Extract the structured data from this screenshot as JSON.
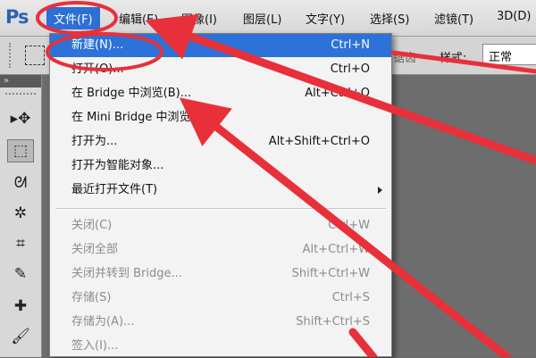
{
  "app": {
    "logo": "Ps"
  },
  "menubar": {
    "items": [
      {
        "label": "文件(F)"
      },
      {
        "label": "编辑(E)"
      },
      {
        "label": "图像(I)"
      },
      {
        "label": "图层(L)"
      },
      {
        "label": "文字(Y)"
      },
      {
        "label": "选择(S)"
      },
      {
        "label": "滤镜(T)"
      },
      {
        "label": "3D(D)"
      }
    ]
  },
  "options_bar": {
    "antialias_fragment": "锯齿",
    "style_label": "样式:",
    "style_value": "正常"
  },
  "toolbox": {
    "header": "»",
    "tools": [
      {
        "icon": "move-icon",
        "glyph": "▸✥"
      },
      {
        "icon": "marquee-icon",
        "glyph": "⬚"
      },
      {
        "icon": "lasso-icon",
        "glyph": "ᘛ"
      },
      {
        "icon": "magic-wand-icon",
        "glyph": "✲"
      },
      {
        "icon": "crop-icon",
        "glyph": "⌗"
      },
      {
        "icon": "eyedropper-icon",
        "glyph": "✎"
      },
      {
        "icon": "healing-brush-icon",
        "glyph": "✚"
      },
      {
        "icon": "brush-icon",
        "glyph": "🖌"
      }
    ]
  },
  "file_menu": {
    "items": [
      {
        "label": "新建(N)...",
        "shortcut": "Ctrl+N",
        "state": "highlight"
      },
      {
        "label": "打开(O)...",
        "shortcut": "Ctrl+O",
        "state": "normal"
      },
      {
        "label": "在 Bridge 中浏览(B)...",
        "shortcut": "Alt+Ctrl+O",
        "state": "normal"
      },
      {
        "label": "在 Mini Bridge 中浏览(G)...",
        "shortcut": "",
        "state": "normal"
      },
      {
        "label": "打开为...",
        "shortcut": "Alt+Shift+Ctrl+O",
        "state": "normal"
      },
      {
        "label": "打开为智能对象...",
        "shortcut": "",
        "state": "normal"
      },
      {
        "label": "最近打开文件(T)",
        "shortcut": "",
        "state": "submenu"
      },
      {
        "label": "关闭(C)",
        "shortcut": "Ctrl+W",
        "state": "disabled"
      },
      {
        "label": "关闭全部",
        "shortcut": "Alt+Ctrl+W",
        "state": "disabled"
      },
      {
        "label": "关闭并转到 Bridge...",
        "shortcut": "Shift+Ctrl+W",
        "state": "disabled"
      },
      {
        "label": "存储(S)",
        "shortcut": "Ctrl+S",
        "state": "disabled"
      },
      {
        "label": "存储为(A)...",
        "shortcut": "Shift+Ctrl+S",
        "state": "disabled"
      },
      {
        "label": "签入(I)...",
        "shortcut": "",
        "state": "disabled"
      }
    ]
  },
  "colors": {
    "highlight": "#2c72d8",
    "annotation": "#e8303a"
  }
}
